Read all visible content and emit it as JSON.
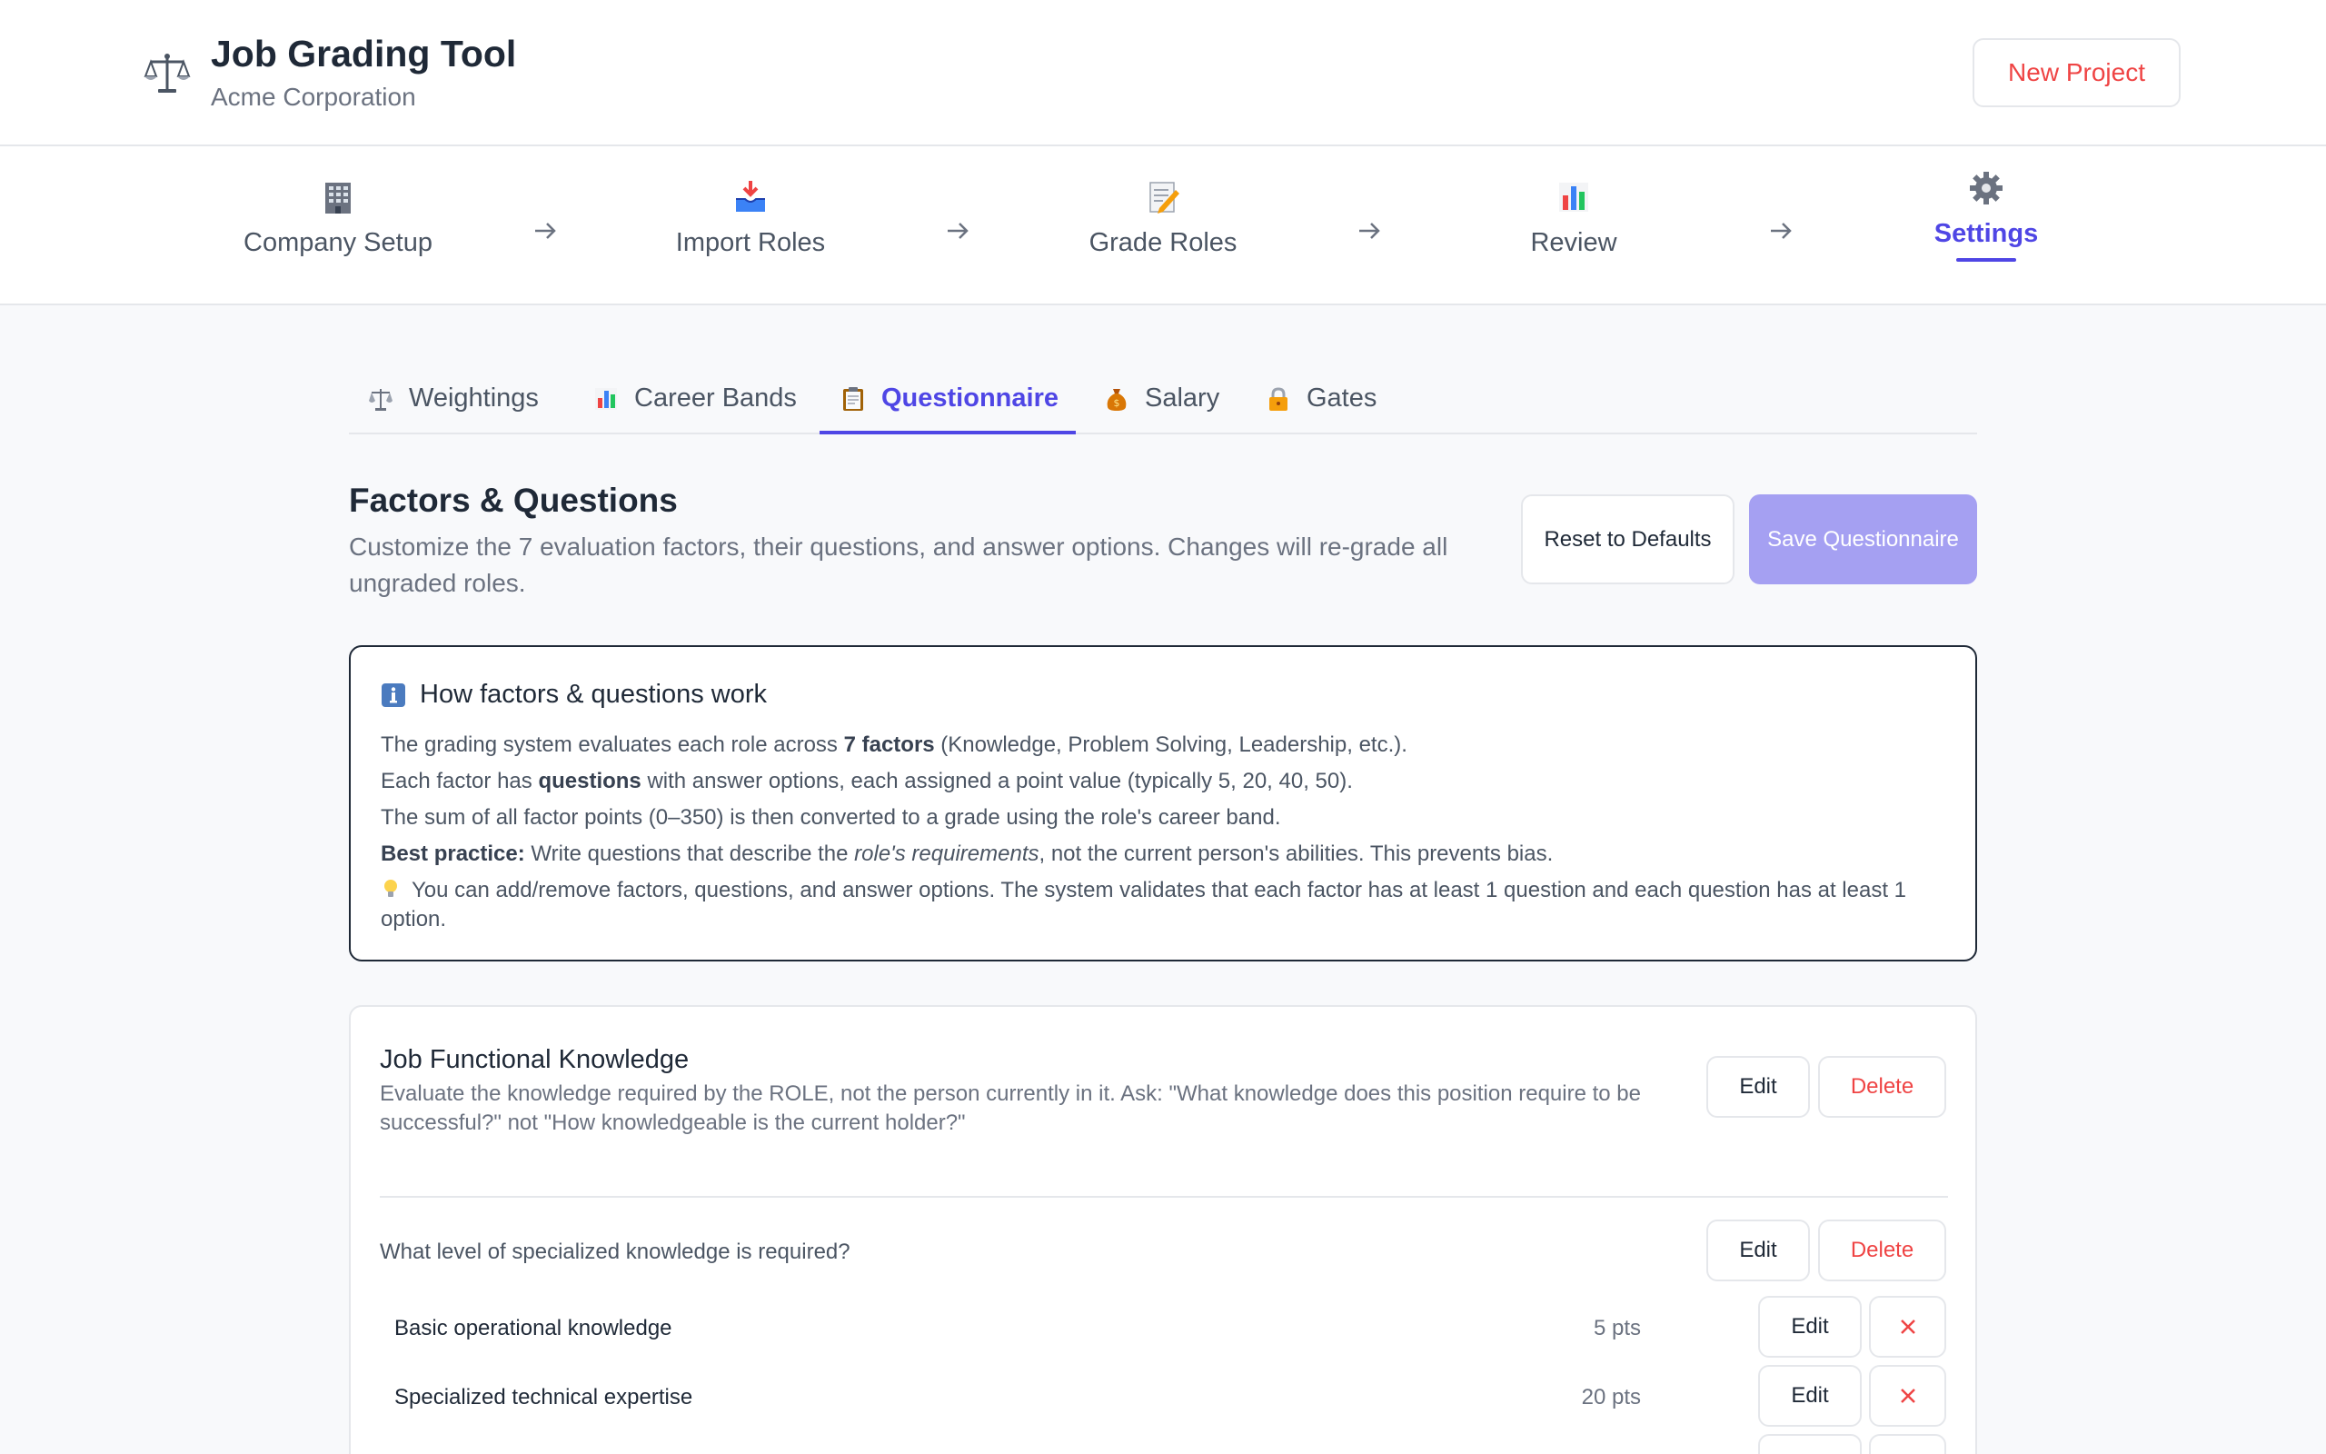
{
  "header": {
    "logo_icon": "balance-scale-icon",
    "title": "Job Grading Tool",
    "company": "Acme Corporation",
    "new_project_label": "New Project"
  },
  "stepper": {
    "steps": [
      {
        "label": "Company Setup",
        "icon": "building-icon"
      },
      {
        "label": "Import Roles",
        "icon": "inbox-tray-icon"
      },
      {
        "label": "Grade Roles",
        "icon": "memo-icon"
      },
      {
        "label": "Review",
        "icon": "bar-chart-icon"
      },
      {
        "label": "Settings",
        "icon": "gear-icon",
        "active": true
      }
    ]
  },
  "subtabs": [
    {
      "label": "Weightings",
      "icon": "balance-scale-icon"
    },
    {
      "label": "Career Bands",
      "icon": "bar-chart-icon"
    },
    {
      "label": "Questionnaire",
      "icon": "clipboard-icon",
      "active": true
    },
    {
      "label": "Salary",
      "icon": "money-bag-icon"
    },
    {
      "label": "Gates",
      "icon": "lock-icon"
    }
  ],
  "section": {
    "title": "Factors & Questions",
    "description": "Customize the 7 evaluation factors, their questions, and answer options. Changes will re-grade all ungraded roles.",
    "reset_label": "Reset to Defaults",
    "save_label": "Save Questionnaire"
  },
  "info": {
    "title": "How factors & questions work",
    "line1_a": "The grading system evaluates each role across ",
    "line1_b": "7 factors",
    "line1_c": " (Knowledge, Problem Solving, Leadership, etc.).",
    "line2_a": "Each factor has ",
    "line2_b": "questions",
    "line2_c": " with answer options, each assigned a point value (typically 5, 20, 40, 50).",
    "line3": "The sum of all factor points (0–350) is then converted to a grade using the role's career band.",
    "line4_a": "Best practice:",
    "line4_b": " Write questions that describe the ",
    "line4_c": "role's requirements",
    "line4_d": ", not the current person's abilities. This prevents bias.",
    "line5": "You can add/remove factors, questions, and answer options. The system validates that each factor has at least 1 question and each question has at least 1 option."
  },
  "factor": {
    "title": "Job Functional Knowledge",
    "description": "Evaluate the knowledge required by the ROLE, not the person currently in it. Ask: \"What knowledge does this position require to be successful?\" not \"How knowledgeable is the current holder?\"",
    "edit_label": "Edit",
    "delete_label": "Delete",
    "question": {
      "text": "What level of specialized knowledge is required?",
      "edit_label": "Edit",
      "delete_label": "Delete",
      "options": [
        {
          "label": "Basic operational knowledge",
          "points": "5 pts",
          "edit_label": "Edit"
        },
        {
          "label": "Specialized technical expertise",
          "points": "20 pts",
          "edit_label": "Edit"
        },
        {
          "label": "",
          "points": "",
          "edit_label": "Edit"
        }
      ]
    }
  },
  "colors": {
    "accent": "#4f46e5",
    "accent_light": "#a5a0f2",
    "danger": "#ef4444"
  }
}
